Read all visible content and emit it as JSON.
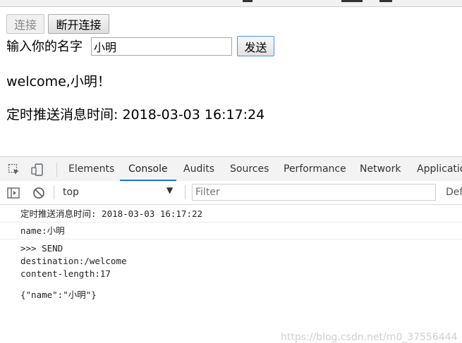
{
  "page": {
    "connect_label": "连接",
    "disconnect_label": "断开连接",
    "name_prompt": "输入你的名字",
    "name_value": "小明",
    "send_label": "发送",
    "welcome_text": "welcome,小明！",
    "timer_text": "定时推送消息时间: 2018-03-03 16:17:24"
  },
  "devtools": {
    "tabs": [
      "Elements",
      "Console",
      "Audits",
      "Sources",
      "Performance",
      "Network",
      "Applicatio"
    ],
    "active_tab": "Console",
    "context": "top",
    "filter_placeholder": "Filter",
    "levels_label": "Def",
    "icons": {
      "inspect": "inspect-element-icon",
      "device": "device-toolbar-icon",
      "sidebar": "console-sidebar-icon",
      "clear": "clear-console-icon",
      "dropdown": "dropdown-arrow-icon"
    }
  },
  "console": {
    "lines": [
      "定时推送消息时间: 2018-03-03 16:17:22",
      "name:小明",
      ">>> SEND",
      "destination:/welcome",
      "content-length:17",
      "{\"name\":\"小明\"}"
    ],
    "watermark": "https://blog.csdn.net/m0_37556444"
  },
  "colors": {
    "active_tab_underline": "#1a73e8",
    "send_border": "#4d90fe"
  }
}
